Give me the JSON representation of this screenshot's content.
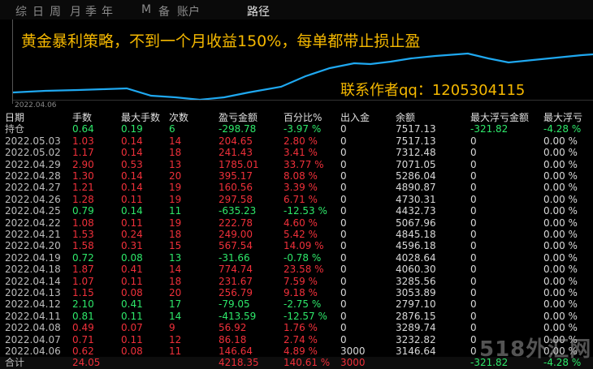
{
  "tabs": [
    "综",
    "日",
    "周",
    "月",
    "季",
    "年",
    "M",
    "备",
    "账户",
    "路径"
  ],
  "active_tab": 9,
  "chart": {
    "title": "黄金暴利策略，不到一个月收益150%，每单都带止损止盈",
    "contact": "联系作者qq：1205304115",
    "x_label": "2022.04.06",
    "line_color": "#1fa8f0"
  },
  "table": {
    "headers": [
      "日期",
      "手数",
      "最大手数",
      "次数",
      "盈亏金额",
      "百分比%",
      "出入金",
      "余额",
      "最大浮亏金额",
      "最大浮亏"
    ],
    "holding": {
      "date": "持仓",
      "lots": "0.64",
      "max_lots": "0.19",
      "count": "6",
      "pl": "-298.78",
      "pct": "-3.97 %",
      "io": "0",
      "bal": "7517.13",
      "float": "-321.82",
      "float_pct": "-4.28 %"
    },
    "rows": [
      {
        "date": "2022.05.03",
        "lots": "1.03",
        "max_lots": "0.14",
        "count": "14",
        "pl": "204.65",
        "pct": "2.80 %",
        "io": "0",
        "bal": "7517.13",
        "float": "0",
        "float_pct": "0.00 %"
      },
      {
        "date": "2022.05.02",
        "lots": "1.17",
        "max_lots": "0.14",
        "count": "18",
        "pl": "241.43",
        "pct": "3.41 %",
        "io": "0",
        "bal": "7312.48",
        "float": "0",
        "float_pct": "0.00 %"
      },
      {
        "date": "2022.04.29",
        "lots": "2.90",
        "max_lots": "0.53",
        "count": "13",
        "pl": "1785.01",
        "pct": "33.77 %",
        "io": "0",
        "bal": "7071.05",
        "float": "0",
        "float_pct": "0.00 %"
      },
      {
        "date": "2022.04.28",
        "lots": "1.30",
        "max_lots": "0.14",
        "count": "20",
        "pl": "395.17",
        "pct": "8.08 %",
        "io": "0",
        "bal": "5286.04",
        "float": "0",
        "float_pct": "0.00 %"
      },
      {
        "date": "2022.04.27",
        "lots": "1.21",
        "max_lots": "0.14",
        "count": "19",
        "pl": "160.56",
        "pct": "3.39 %",
        "io": "0",
        "bal": "4890.87",
        "float": "0",
        "float_pct": "0.00 %"
      },
      {
        "date": "2022.04.26",
        "lots": "1.28",
        "max_lots": "0.11",
        "count": "19",
        "pl": "297.58",
        "pct": "6.71 %",
        "io": "0",
        "bal": "4730.31",
        "float": "0",
        "float_pct": "0.00 %"
      },
      {
        "date": "2022.04.25",
        "lots": "0.79",
        "max_lots": "0.14",
        "count": "11",
        "pl": "-635.23",
        "pct": "-12.53 %",
        "io": "0",
        "bal": "4432.73",
        "float": "0",
        "float_pct": "0.00 %"
      },
      {
        "date": "2022.04.22",
        "lots": "1.08",
        "max_lots": "0.11",
        "count": "19",
        "pl": "222.78",
        "pct": "4.60 %",
        "io": "0",
        "bal": "5067.96",
        "float": "0",
        "float_pct": "0.00 %"
      },
      {
        "date": "2022.04.21",
        "lots": "1.53",
        "max_lots": "0.24",
        "count": "18",
        "pl": "249.00",
        "pct": "5.42 %",
        "io": "0",
        "bal": "4845.18",
        "float": "0",
        "float_pct": "0.00 %"
      },
      {
        "date": "2022.04.20",
        "lots": "1.58",
        "max_lots": "0.31",
        "count": "15",
        "pl": "567.54",
        "pct": "14.09 %",
        "io": "0",
        "bal": "4596.18",
        "float": "0",
        "float_pct": "0.00 %"
      },
      {
        "date": "2022.04.19",
        "lots": "0.72",
        "max_lots": "0.08",
        "count": "13",
        "pl": "-31.66",
        "pct": "-0.78 %",
        "io": "0",
        "bal": "4028.64",
        "float": "0",
        "float_pct": "0.00 %"
      },
      {
        "date": "2022.04.18",
        "lots": "1.87",
        "max_lots": "0.41",
        "count": "14",
        "pl": "774.74",
        "pct": "23.58 %",
        "io": "0",
        "bal": "4060.30",
        "float": "0",
        "float_pct": "0.00 %"
      },
      {
        "date": "2022.04.14",
        "lots": "1.07",
        "max_lots": "0.11",
        "count": "18",
        "pl": "231.67",
        "pct": "7.59 %",
        "io": "0",
        "bal": "3285.56",
        "float": "0",
        "float_pct": "0.00 %"
      },
      {
        "date": "2022.04.13",
        "lots": "1.15",
        "max_lots": "0.08",
        "count": "20",
        "pl": "256.79",
        "pct": "9.18 %",
        "io": "0",
        "bal": "3053.89",
        "float": "0",
        "float_pct": "0.00 %"
      },
      {
        "date": "2022.04.12",
        "lots": "2.10",
        "max_lots": "0.41",
        "count": "17",
        "pl": "-79.05",
        "pct": "-2.75 %",
        "io": "0",
        "bal": "2797.10",
        "float": "0",
        "float_pct": "0.00 %"
      },
      {
        "date": "2022.04.11",
        "lots": "0.81",
        "max_lots": "0.11",
        "count": "14",
        "pl": "-413.59",
        "pct": "-12.57 %",
        "io": "0",
        "bal": "2876.15",
        "float": "0",
        "float_pct": "0.00 %"
      },
      {
        "date": "2022.04.08",
        "lots": "0.49",
        "max_lots": "0.07",
        "count": "9",
        "pl": "56.92",
        "pct": "1.76 %",
        "io": "0",
        "bal": "3289.74",
        "float": "0",
        "float_pct": "0.00 %"
      },
      {
        "date": "2022.04.07",
        "lots": "0.71",
        "max_lots": "0.11",
        "count": "12",
        "pl": "86.18",
        "pct": "2.74 %",
        "io": "0",
        "bal": "3232.82",
        "float": "0",
        "float_pct": "0.00 %"
      },
      {
        "date": "2022.04.06",
        "lots": "0.62",
        "max_lots": "0.08",
        "count": "11",
        "pl": "146.64",
        "pct": "4.89 %",
        "io": "3000",
        "bal": "3146.64",
        "float": "0",
        "float_pct": "0.00 %"
      }
    ],
    "total": {
      "date": "合计",
      "lots": "24.05",
      "pl": "4218.35",
      "pct": "140.61 %",
      "io": "3000",
      "float": "-321.82",
      "float_pct": "-4.28 %"
    }
  },
  "watermark": "518外汇网",
  "colors": {
    "positive": "#f0303a",
    "negative": "#2ee86a",
    "title": "#f5b800"
  }
}
